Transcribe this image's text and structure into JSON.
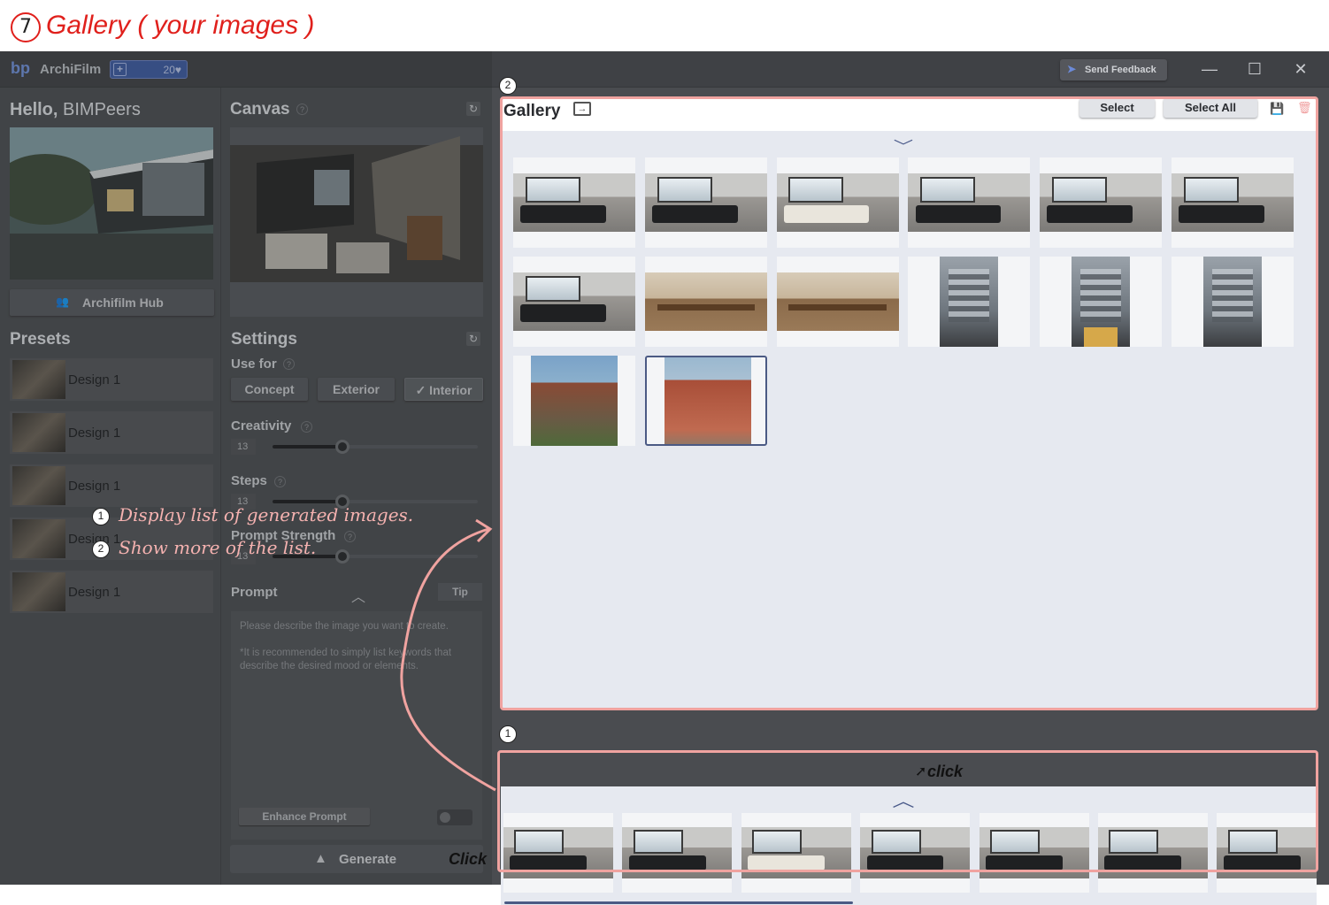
{
  "tutorial": {
    "step": "7",
    "title": "Gallery ( your images )"
  },
  "titlebar": {
    "logo": "bp",
    "app_name": "ArchiFilm",
    "credits_plus": "+",
    "credits": "20",
    "credits_icon": "heart-icon",
    "feedback_icon": "send-icon",
    "feedback_label": "Send Feedback",
    "minimize": "—",
    "maximize": "☐",
    "close": "✕"
  },
  "sidebar": {
    "hello": "Hello,",
    "user": "BIMPeers",
    "hub_icon": "users-icon",
    "hub_label": "Archifilm Hub",
    "presets_title": "Presets",
    "presets": [
      {
        "label": "Design 1"
      },
      {
        "label": "Design 1"
      },
      {
        "label": "Design 1"
      },
      {
        "label": "Design 1"
      },
      {
        "label": "Design 1"
      }
    ]
  },
  "canvas": {
    "title": "Canvas",
    "help": "?",
    "refresh": "↻"
  },
  "settings": {
    "title": "Settings",
    "refresh": "↻",
    "use_for_label": "Use for",
    "help": "?",
    "use_for_options": [
      {
        "label": "Concept"
      },
      {
        "label": "Exterior"
      },
      {
        "label": "✓ Interior"
      }
    ],
    "use_for_selected": "Interior",
    "sliders": [
      {
        "label": "Creativity",
        "value": "13",
        "fill": 0.34
      },
      {
        "label": "Steps",
        "value": "13",
        "fill": 0.34
      },
      {
        "label": "Prompt Strength",
        "value": "13",
        "fill": 0.34
      }
    ]
  },
  "prompt": {
    "title": "Prompt",
    "collapse_icon": "︿",
    "tip_label": "Tip",
    "placeholder": "Please describe the image you want to create.\n\n*It is recommended to simply list keywords that describe the desired mood or elements.",
    "enhance_label": "Enhance Prompt",
    "generate_icon": "mountain-icon",
    "generate_label": "Generate"
  },
  "gallery": {
    "title": "Gallery",
    "folder_icon": "folder-export-icon",
    "select_label": "Select",
    "select_all_label": "Select All",
    "save_icon": "save-icon",
    "trash_icon": "trash-icon",
    "expand_icon": "﹀",
    "images": [
      {
        "type": "interior"
      },
      {
        "type": "interior"
      },
      {
        "type": "interior-warm"
      },
      {
        "type": "interior"
      },
      {
        "type": "interior"
      },
      {
        "type": "interior"
      },
      {
        "type": "interior"
      },
      {
        "type": "office"
      },
      {
        "type": "office"
      },
      {
        "type": "building"
      },
      {
        "type": "building-yellow"
      },
      {
        "type": "building"
      },
      {
        "type": "brick"
      },
      {
        "type": "brick-selected"
      }
    ]
  },
  "strip": {
    "collapse_icon": "︿",
    "images": [
      {
        "type": "interior"
      },
      {
        "type": "interior"
      },
      {
        "type": "interior-warm"
      },
      {
        "type": "interior"
      },
      {
        "type": "interior"
      },
      {
        "type": "interior"
      },
      {
        "type": "interior"
      }
    ]
  },
  "annotations": {
    "marker_2": "2",
    "marker_1": "1",
    "note_1_num": "1",
    "note_1": "Display list of generated images.",
    "note_2_num": "2",
    "note_2": "Show more of the list.",
    "click_strip": "click",
    "click_generate": "Click",
    "colors": {
      "annotation": "#f0a3a0",
      "title": "#e0201c",
      "accent": "#4b5a84"
    }
  }
}
